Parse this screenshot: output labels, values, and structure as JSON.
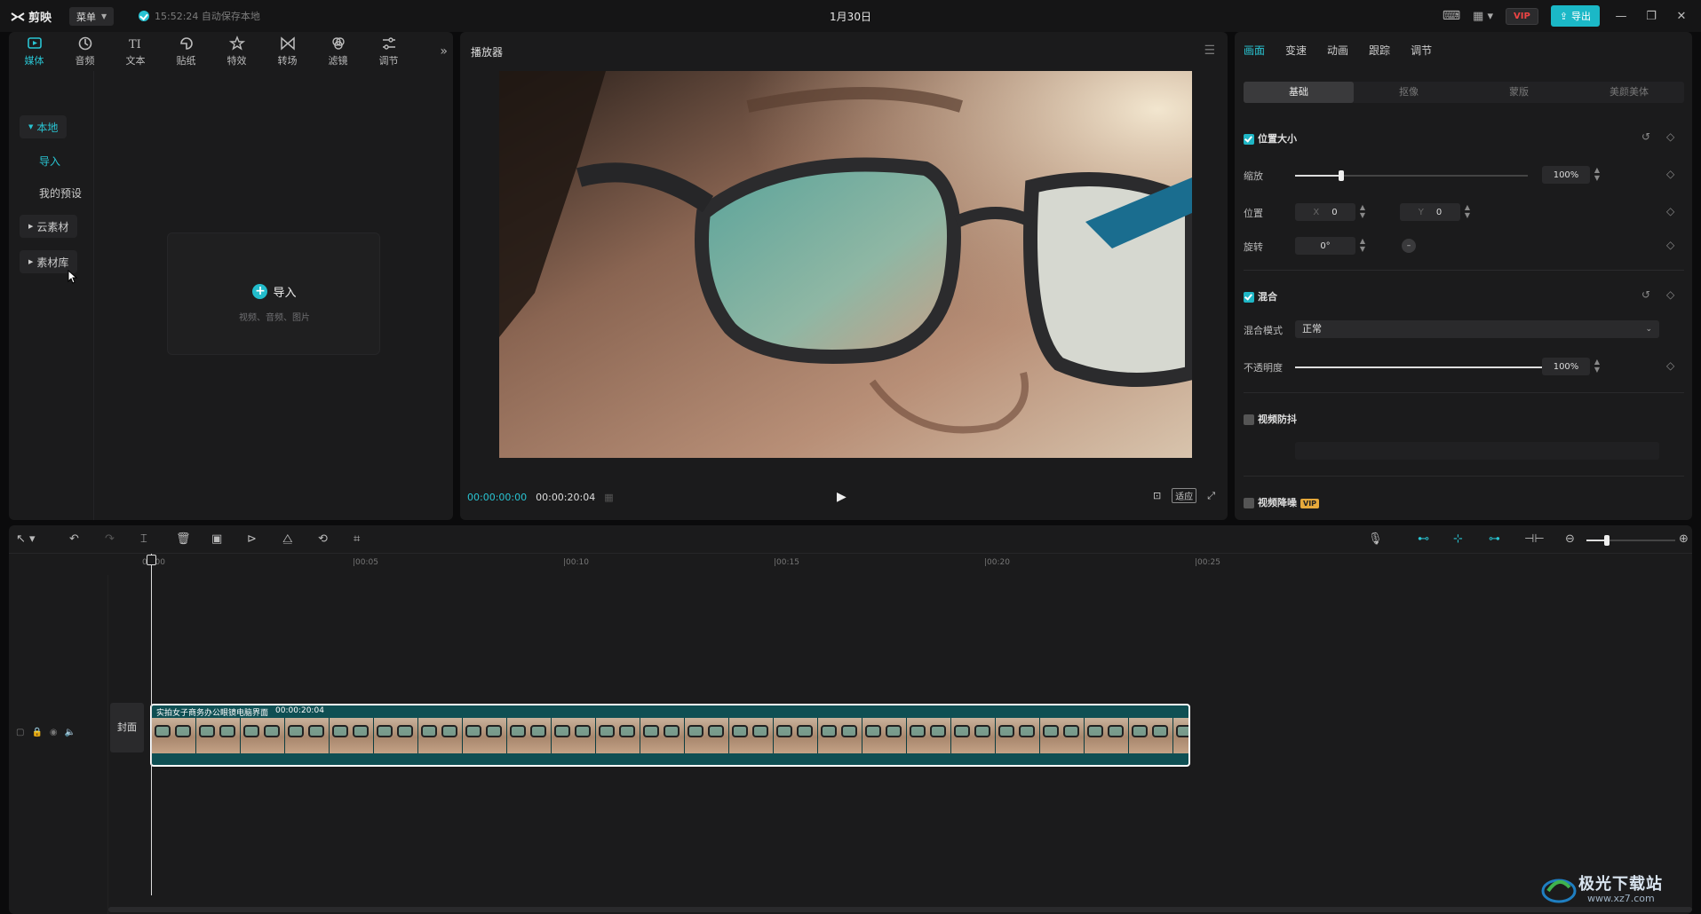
{
  "titlebar": {
    "app_name": "剪映",
    "menu_label": "菜单",
    "autosave": "15:52:24 自动保存本地",
    "project_title": "1月30日",
    "vip_label": "VIP",
    "export_label": "导出"
  },
  "left": {
    "tools": [
      {
        "label": "媒体",
        "icon": "media-icon",
        "active": true
      },
      {
        "label": "音频",
        "icon": "audio-icon"
      },
      {
        "label": "文本",
        "icon": "text-icon"
      },
      {
        "label": "贴纸",
        "icon": "sticker-icon"
      },
      {
        "label": "特效",
        "icon": "effects-icon"
      },
      {
        "label": "转场",
        "icon": "transition-icon"
      },
      {
        "label": "滤镜",
        "icon": "filter-icon"
      },
      {
        "label": "调节",
        "icon": "adjust-icon"
      }
    ],
    "nav": {
      "local": "本地",
      "import": "导入",
      "my_presets": "我的预设",
      "cloud": "云素材",
      "library": "素材库"
    },
    "import_card": {
      "title": "导入",
      "subtitle": "视频、音频、图片"
    }
  },
  "player": {
    "title": "播放器",
    "current_time": "00:00:00:00",
    "total_time": "00:00:20:04",
    "fit_label": "适应"
  },
  "props": {
    "tabs": [
      "画面",
      "变速",
      "动画",
      "跟踪",
      "调节"
    ],
    "active_tab": "画面",
    "subtabs": [
      "基础",
      "抠像",
      "蒙版",
      "美颜美体"
    ],
    "position_size": {
      "title": "位置大小",
      "scale_label": "缩放",
      "scale_value": "100%",
      "scale_fraction": 0.2,
      "position_label": "位置",
      "x_label": "X",
      "x_value": "0",
      "y_label": "Y",
      "y_value": "0",
      "rotate_label": "旋转",
      "rotate_value": "0°"
    },
    "blend": {
      "title": "混合",
      "mode_label": "混合模式",
      "mode_value": "正常",
      "opacity_label": "不透明度",
      "opacity_value": "100%",
      "opacity_fraction": 1.0
    },
    "stabilize": {
      "title": "视频防抖"
    },
    "denoise": {
      "title": "视频降噪",
      "badge": "VIP"
    }
  },
  "timeline": {
    "ruler_ticks": [
      "00:00",
      "|00:05",
      "|00:10",
      "|00:15",
      "|00:20",
      "|00:25"
    ],
    "cover_label": "封面",
    "clip": {
      "name": "实拍女子商务办公眼镜电脑界面",
      "duration": "00:00:20:04"
    },
    "watermark": "极光下载站",
    "watermark_url": "www.xz7.com"
  },
  "colors": {
    "accent": "#29c4d2",
    "clip_bg": "#0f4f53",
    "vip": "#e6a93b"
  }
}
